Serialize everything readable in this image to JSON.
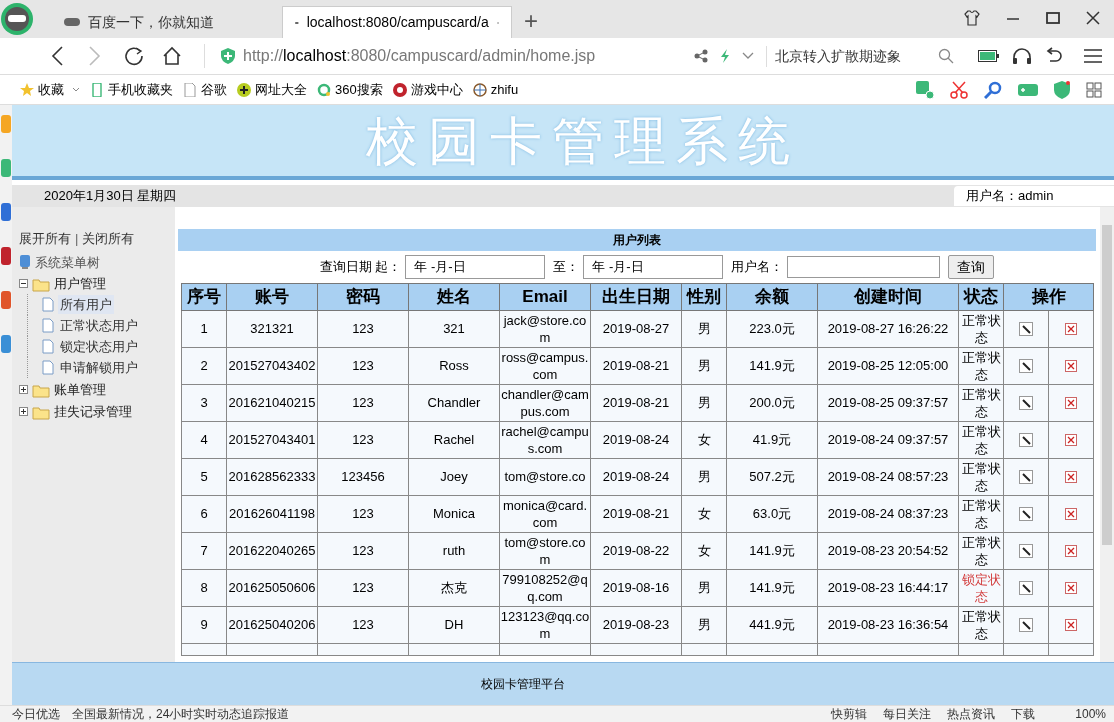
{
  "browser": {
    "tabs": [
      {
        "title": "百度一下，你就知道",
        "selected": false
      },
      {
        "title": "localhost:8080/campuscard/a",
        "selected": true
      }
    ],
    "new_tab": "+",
    "url_prefix": "http://",
    "url_host": "localhost",
    "url_rest": ":8080/campuscard/admin/home.jsp",
    "search_placeholder": "北京转入扩散期迹象",
    "bookmarks": [
      "收藏",
      "手机收藏夹",
      "谷歌",
      "网址大全",
      "360搜索",
      "游戏中心",
      "zhifu"
    ]
  },
  "app": {
    "title": "校园卡管理系统",
    "date": "2020年1月30日 星期四",
    "user": "用户名：admin",
    "sidebar": {
      "expand_all": "展开所有",
      "separator": "|",
      "collapse_all": "关闭所有",
      "root": "系统菜单树",
      "tree": [
        {
          "label": "用户管理",
          "expanded": true,
          "children": [
            {
              "label": "所有用户",
              "selected": true
            },
            {
              "label": "正常状态用户",
              "selected": false
            },
            {
              "label": "锁定状态用户",
              "selected": false
            },
            {
              "label": "申请解锁用户",
              "selected": false
            }
          ]
        },
        {
          "label": "账单管理",
          "expanded": false
        },
        {
          "label": "挂失记录管理",
          "expanded": false
        }
      ]
    },
    "panel_title": "用户列表",
    "filter": {
      "date_label": "查询日期 起：",
      "date_from": "年 -月-日",
      "to_label": "至：",
      "date_to": "年 -月-日",
      "user_label": "用户名：",
      "search_button": "查询"
    },
    "table": {
      "columns": [
        "序号",
        "账号",
        "密码",
        "姓名",
        "Email",
        "出生日期",
        "性别",
        "余额",
        "创建时间",
        "状态",
        "操作"
      ],
      "rows": [
        {
          "no": "1",
          "account": "321321",
          "password": "123",
          "name": "321",
          "email": "jack@store.com",
          "birth": "2019-08-27",
          "gender": "男",
          "balance": "223.0元",
          "created": "2019-08-27 16:26:22",
          "status": "正常状态",
          "locked": false
        },
        {
          "no": "2",
          "account": "201527043402",
          "password": "123",
          "name": "Ross",
          "email": "ross@campus.com",
          "birth": "2019-08-21",
          "gender": "男",
          "balance": "141.9元",
          "created": "2019-08-25 12:05:00",
          "status": "正常状态",
          "locked": false
        },
        {
          "no": "3",
          "account": "201621040215",
          "password": "123",
          "name": "Chandler",
          "email": "chandler@campus.com",
          "birth": "2019-08-21",
          "gender": "男",
          "balance": "200.0元",
          "created": "2019-08-25 09:37:57",
          "status": "正常状态",
          "locked": false
        },
        {
          "no": "4",
          "account": "201527043401",
          "password": "123",
          "name": "Rachel",
          "email": "rachel@campus.com",
          "birth": "2019-08-24",
          "gender": "女",
          "balance": "41.9元",
          "created": "2019-08-24 09:37:57",
          "status": "正常状态",
          "locked": false
        },
        {
          "no": "5",
          "account": "201628562333",
          "password": "123456",
          "name": "Joey",
          "email": "tom@store.co",
          "birth": "2019-08-24",
          "gender": "男",
          "balance": "507.2元",
          "created": "2019-08-24 08:57:23",
          "status": "正常状态",
          "locked": false
        },
        {
          "no": "6",
          "account": "201626041198",
          "password": "123",
          "name": "Monica",
          "email": "monica@card.com",
          "birth": "2019-08-21",
          "gender": "女",
          "balance": "63.0元",
          "created": "2019-08-24 08:37:23",
          "status": "正常状态",
          "locked": false
        },
        {
          "no": "7",
          "account": "201622040265",
          "password": "123",
          "name": "ruth",
          "email": "tom@store.com",
          "birth": "2019-08-22",
          "gender": "女",
          "balance": "141.9元",
          "created": "2019-08-23 20:54:52",
          "status": "正常状态",
          "locked": false
        },
        {
          "no": "8",
          "account": "201625050606",
          "password": "123",
          "name": "杰克",
          "email": "799108252@qq.com",
          "birth": "2019-08-16",
          "gender": "男",
          "balance": "141.9元",
          "created": "2019-08-23 16:44:17",
          "status": "锁定状态",
          "locked": true
        },
        {
          "no": "9",
          "account": "201625040206",
          "password": "123",
          "name": "DH",
          "email": "123123@qq.com",
          "birth": "2019-08-23",
          "gender": "男",
          "balance": "441.9元",
          "created": "2019-08-23 16:36:54",
          "status": "正常状态",
          "locked": false
        }
      ]
    },
    "footer": "校园卡管理平台"
  },
  "status_bar": {
    "left": [
      "今日优选",
      "全国最新情况，24小时实时动态追踪报道"
    ],
    "right": [
      "快剪辑",
      "每日关注",
      "热点资讯",
      "下载"
    ],
    "zoom": "100%"
  }
}
